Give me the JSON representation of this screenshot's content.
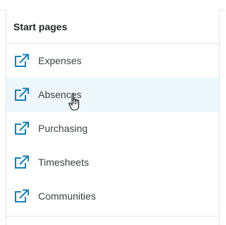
{
  "panel": {
    "title": "Start pages",
    "items": [
      {
        "label": "Expenses",
        "icon": "external-link-icon"
      },
      {
        "label": "Absences",
        "icon": "external-link-icon"
      },
      {
        "label": "Purchasing",
        "icon": "external-link-icon"
      },
      {
        "label": "Timesheets",
        "icon": "external-link-icon"
      },
      {
        "label": "Communities",
        "icon": "external-link-icon"
      }
    ]
  },
  "colors": {
    "accent": "#1b7fb3",
    "hover_background": "#eef7fb",
    "divider": "#e3e6e8"
  }
}
